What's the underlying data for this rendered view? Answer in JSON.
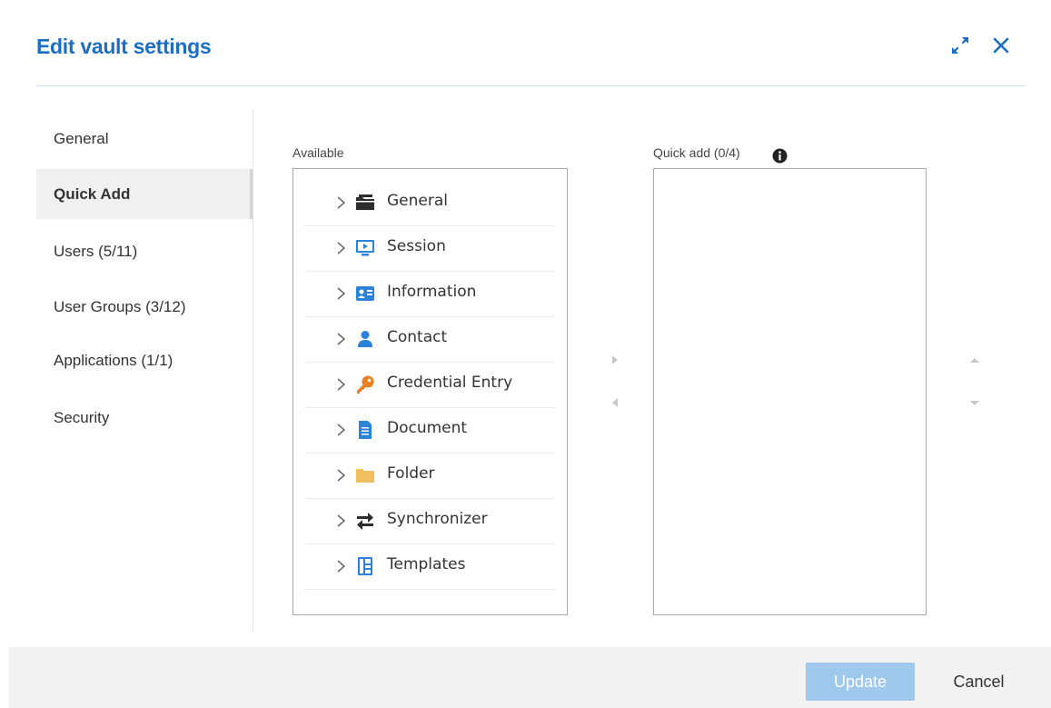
{
  "dialog": {
    "title": "Edit vault settings",
    "icons": [
      "expand-icon",
      "close-icon"
    ]
  },
  "sidebar": {
    "items": [
      {
        "label": "General"
      },
      {
        "label": "Quick Add",
        "active": true
      },
      {
        "label": "Users (5/11)"
      },
      {
        "label": "User Groups (3/12)"
      },
      {
        "label": "Applications (1/1)"
      },
      {
        "label": "Security"
      }
    ]
  },
  "available": {
    "label": "Available",
    "items": [
      {
        "label": "General",
        "icon": "folder-dark-icon"
      },
      {
        "label": "Session",
        "icon": "session-monitor-icon"
      },
      {
        "label": "Information",
        "icon": "information-card-icon"
      },
      {
        "label": "Contact",
        "icon": "person-icon"
      },
      {
        "label": "Credential Entry",
        "icon": "key-icon"
      },
      {
        "label": "Document",
        "icon": "document-icon"
      },
      {
        "label": "Folder",
        "icon": "folder-icon"
      },
      {
        "label": "Synchronizer",
        "icon": "sync-arrows-icon"
      },
      {
        "label": "Templates",
        "icon": "templates-icon"
      }
    ]
  },
  "quick_add": {
    "label": "Quick add (0/4)",
    "items": []
  },
  "footer": {
    "update_label": "Update",
    "cancel_label": "Cancel"
  },
  "colors": {
    "accent": "#1a6fc4",
    "icon_blue": "#2b82d9",
    "key_orange": "#e8801e",
    "folder_yellow": "#f0c060",
    "update_disabled": "#9ec8ec"
  }
}
